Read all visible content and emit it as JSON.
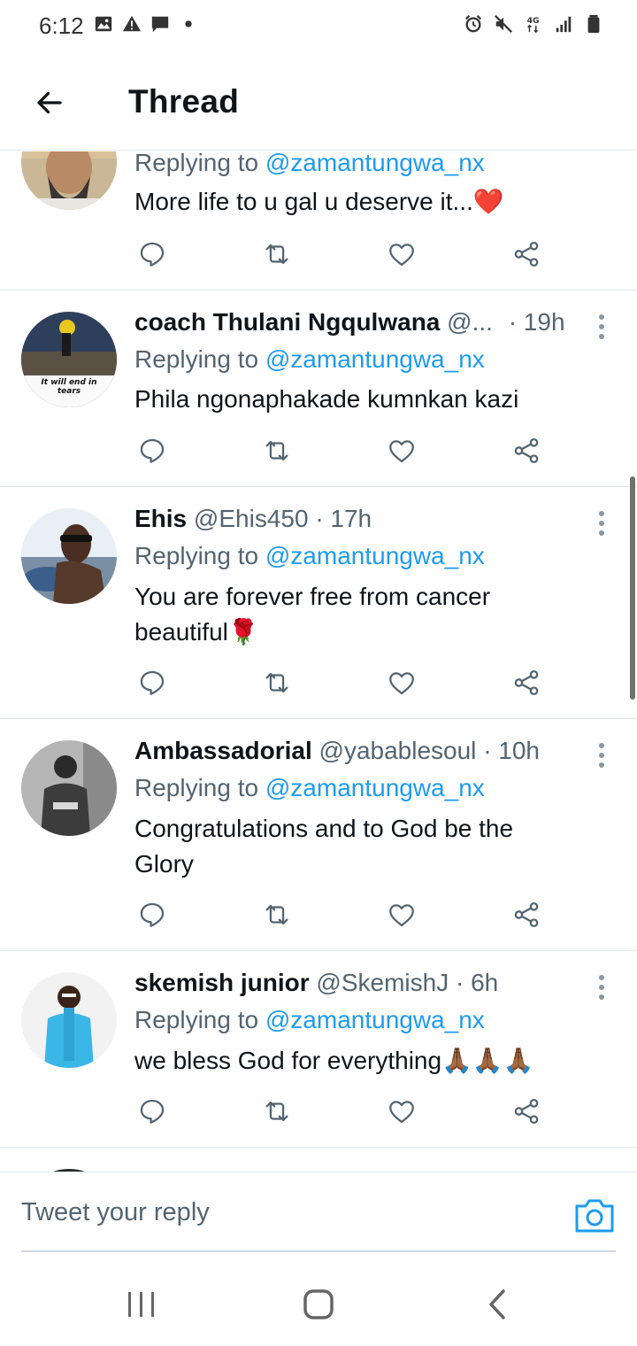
{
  "status_bar": {
    "time": "6:12",
    "network": "4G",
    "icons_left": [
      "gallery-icon",
      "alert-icon",
      "message-icon",
      "dot-icon"
    ],
    "icons_right": [
      "alarm-icon",
      "mute-icon",
      "network-4g-icon",
      "signal-icon",
      "battery-icon"
    ]
  },
  "header": {
    "title": "Thread"
  },
  "replying_prefix": "Replying to",
  "tweets": [
    {
      "name": "",
      "handle": "",
      "time": "",
      "replying_to": "@zamantungwa_nx",
      "text": "More life to u gal u deserve it...❤️"
    },
    {
      "name": "coach Thulani Ngqulwana",
      "handle": "@...",
      "time": "· 19h",
      "replying_to": "@zamantungwa_nx",
      "text": "Phila ngonaphakade kumnkan kazi",
      "avatar_caption": "It will end in tears"
    },
    {
      "name": "Ehis",
      "handle": "@Ehis450",
      "time": "· 17h",
      "replying_to": "@zamantungwa_nx",
      "text": "You are forever free from cancer beautiful🌹"
    },
    {
      "name": "Ambassadorial",
      "handle": "@yabablesoul",
      "time": "· 10h",
      "replying_to": "@zamantungwa_nx",
      "text": "Congratulations and to God be the Glory"
    },
    {
      "name": "skemish junior",
      "handle": "@SkemishJ",
      "time": "· 6h",
      "replying_to": "@zamantungwa_nx",
      "text": "we bless God for everything🙏🏾🙏🏾🙏🏾"
    }
  ],
  "reply_bar": {
    "placeholder": "Tweet your reply"
  },
  "colors": {
    "accent": "#1d9bf0",
    "text_primary": "#0f1419",
    "text_secondary": "#536471",
    "divider": "#e1e8ed"
  },
  "nav_bar": {
    "icons": [
      "recent-apps-icon",
      "home-icon",
      "back-nav-icon"
    ]
  }
}
